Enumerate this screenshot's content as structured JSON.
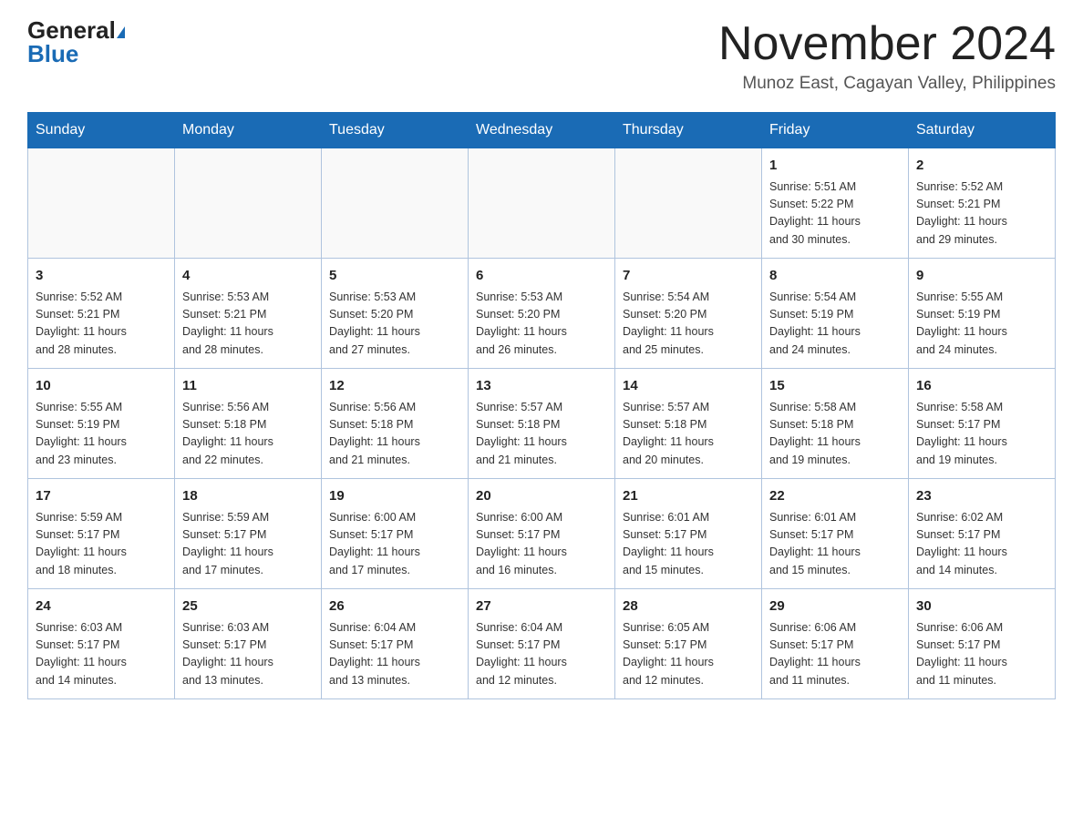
{
  "logo": {
    "text_general": "General",
    "text_blue": "Blue",
    "triangle": "▲"
  },
  "header": {
    "month_title": "November 2024",
    "location": "Munoz East, Cagayan Valley, Philippines"
  },
  "weekdays": [
    "Sunday",
    "Monday",
    "Tuesday",
    "Wednesday",
    "Thursday",
    "Friday",
    "Saturday"
  ],
  "weeks": [
    [
      {
        "day": "",
        "info": ""
      },
      {
        "day": "",
        "info": ""
      },
      {
        "day": "",
        "info": ""
      },
      {
        "day": "",
        "info": ""
      },
      {
        "day": "",
        "info": ""
      },
      {
        "day": "1",
        "info": "Sunrise: 5:51 AM\nSunset: 5:22 PM\nDaylight: 11 hours\nand 30 minutes."
      },
      {
        "day": "2",
        "info": "Sunrise: 5:52 AM\nSunset: 5:21 PM\nDaylight: 11 hours\nand 29 minutes."
      }
    ],
    [
      {
        "day": "3",
        "info": "Sunrise: 5:52 AM\nSunset: 5:21 PM\nDaylight: 11 hours\nand 28 minutes."
      },
      {
        "day": "4",
        "info": "Sunrise: 5:53 AM\nSunset: 5:21 PM\nDaylight: 11 hours\nand 28 minutes."
      },
      {
        "day": "5",
        "info": "Sunrise: 5:53 AM\nSunset: 5:20 PM\nDaylight: 11 hours\nand 27 minutes."
      },
      {
        "day": "6",
        "info": "Sunrise: 5:53 AM\nSunset: 5:20 PM\nDaylight: 11 hours\nand 26 minutes."
      },
      {
        "day": "7",
        "info": "Sunrise: 5:54 AM\nSunset: 5:20 PM\nDaylight: 11 hours\nand 25 minutes."
      },
      {
        "day": "8",
        "info": "Sunrise: 5:54 AM\nSunset: 5:19 PM\nDaylight: 11 hours\nand 24 minutes."
      },
      {
        "day": "9",
        "info": "Sunrise: 5:55 AM\nSunset: 5:19 PM\nDaylight: 11 hours\nand 24 minutes."
      }
    ],
    [
      {
        "day": "10",
        "info": "Sunrise: 5:55 AM\nSunset: 5:19 PM\nDaylight: 11 hours\nand 23 minutes."
      },
      {
        "day": "11",
        "info": "Sunrise: 5:56 AM\nSunset: 5:18 PM\nDaylight: 11 hours\nand 22 minutes."
      },
      {
        "day": "12",
        "info": "Sunrise: 5:56 AM\nSunset: 5:18 PM\nDaylight: 11 hours\nand 21 minutes."
      },
      {
        "day": "13",
        "info": "Sunrise: 5:57 AM\nSunset: 5:18 PM\nDaylight: 11 hours\nand 21 minutes."
      },
      {
        "day": "14",
        "info": "Sunrise: 5:57 AM\nSunset: 5:18 PM\nDaylight: 11 hours\nand 20 minutes."
      },
      {
        "day": "15",
        "info": "Sunrise: 5:58 AM\nSunset: 5:18 PM\nDaylight: 11 hours\nand 19 minutes."
      },
      {
        "day": "16",
        "info": "Sunrise: 5:58 AM\nSunset: 5:17 PM\nDaylight: 11 hours\nand 19 minutes."
      }
    ],
    [
      {
        "day": "17",
        "info": "Sunrise: 5:59 AM\nSunset: 5:17 PM\nDaylight: 11 hours\nand 18 minutes."
      },
      {
        "day": "18",
        "info": "Sunrise: 5:59 AM\nSunset: 5:17 PM\nDaylight: 11 hours\nand 17 minutes."
      },
      {
        "day": "19",
        "info": "Sunrise: 6:00 AM\nSunset: 5:17 PM\nDaylight: 11 hours\nand 17 minutes."
      },
      {
        "day": "20",
        "info": "Sunrise: 6:00 AM\nSunset: 5:17 PM\nDaylight: 11 hours\nand 16 minutes."
      },
      {
        "day": "21",
        "info": "Sunrise: 6:01 AM\nSunset: 5:17 PM\nDaylight: 11 hours\nand 15 minutes."
      },
      {
        "day": "22",
        "info": "Sunrise: 6:01 AM\nSunset: 5:17 PM\nDaylight: 11 hours\nand 15 minutes."
      },
      {
        "day": "23",
        "info": "Sunrise: 6:02 AM\nSunset: 5:17 PM\nDaylight: 11 hours\nand 14 minutes."
      }
    ],
    [
      {
        "day": "24",
        "info": "Sunrise: 6:03 AM\nSunset: 5:17 PM\nDaylight: 11 hours\nand 14 minutes."
      },
      {
        "day": "25",
        "info": "Sunrise: 6:03 AM\nSunset: 5:17 PM\nDaylight: 11 hours\nand 13 minutes."
      },
      {
        "day": "26",
        "info": "Sunrise: 6:04 AM\nSunset: 5:17 PM\nDaylight: 11 hours\nand 13 minutes."
      },
      {
        "day": "27",
        "info": "Sunrise: 6:04 AM\nSunset: 5:17 PM\nDaylight: 11 hours\nand 12 minutes."
      },
      {
        "day": "28",
        "info": "Sunrise: 6:05 AM\nSunset: 5:17 PM\nDaylight: 11 hours\nand 12 minutes."
      },
      {
        "day": "29",
        "info": "Sunrise: 6:06 AM\nSunset: 5:17 PM\nDaylight: 11 hours\nand 11 minutes."
      },
      {
        "day": "30",
        "info": "Sunrise: 6:06 AM\nSunset: 5:17 PM\nDaylight: 11 hours\nand 11 minutes."
      }
    ]
  ]
}
